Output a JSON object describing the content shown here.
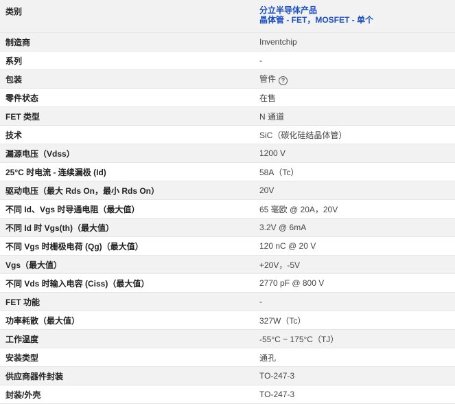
{
  "category": {
    "label": "类别",
    "links": [
      "分立半导体产品",
      "晶体管 - FET，MOSFET - 单个"
    ]
  },
  "rows": [
    {
      "label": "制造商",
      "value": "Inventchip"
    },
    {
      "label": "系列",
      "value": "-"
    },
    {
      "label": "包装",
      "value": "管件",
      "help_icon": "help-circle-icon"
    },
    {
      "label": "零件状态",
      "value": "在售"
    },
    {
      "label": "FET 类型",
      "value": "N 通道"
    },
    {
      "label": "技术",
      "value": "SiC（碳化硅结晶体管）"
    },
    {
      "label": "漏源电压（Vdss）",
      "value": "1200 V"
    },
    {
      "label": "25°C 时电流 - 连续漏极 (Id)",
      "value": "58A（Tc）"
    },
    {
      "label": "驱动电压（最大 Rds On，最小 Rds On）",
      "value": "20V"
    },
    {
      "label": "不同 Id、Vgs 时导通电阻（最大值）",
      "value": "65 毫欧 @ 20A，20V"
    },
    {
      "label": "不同 Id 时 Vgs(th)（最大值）",
      "value": "3.2V @ 6mA"
    },
    {
      "label": "不同 Vgs 时栅极电荷 (Qg)（最大值）",
      "value": "120 nC @ 20 V"
    },
    {
      "label": "Vgs（最大值）",
      "value": "+20V，-5V"
    },
    {
      "label": "不同 Vds 时输入电容 (Ciss)（最大值）",
      "value": "2770 pF @ 800 V"
    },
    {
      "label": "FET 功能",
      "value": "-"
    },
    {
      "label": "功率耗散（最大值）",
      "value": "327W（Tc）"
    },
    {
      "label": "工作温度",
      "value": "-55°C ~ 175°C（TJ）"
    },
    {
      "label": "安装类型",
      "value": "通孔"
    },
    {
      "label": "供应商器件封装",
      "value": "TO-247-3"
    },
    {
      "label": "封装/外壳",
      "value": "TO-247-3"
    }
  ]
}
